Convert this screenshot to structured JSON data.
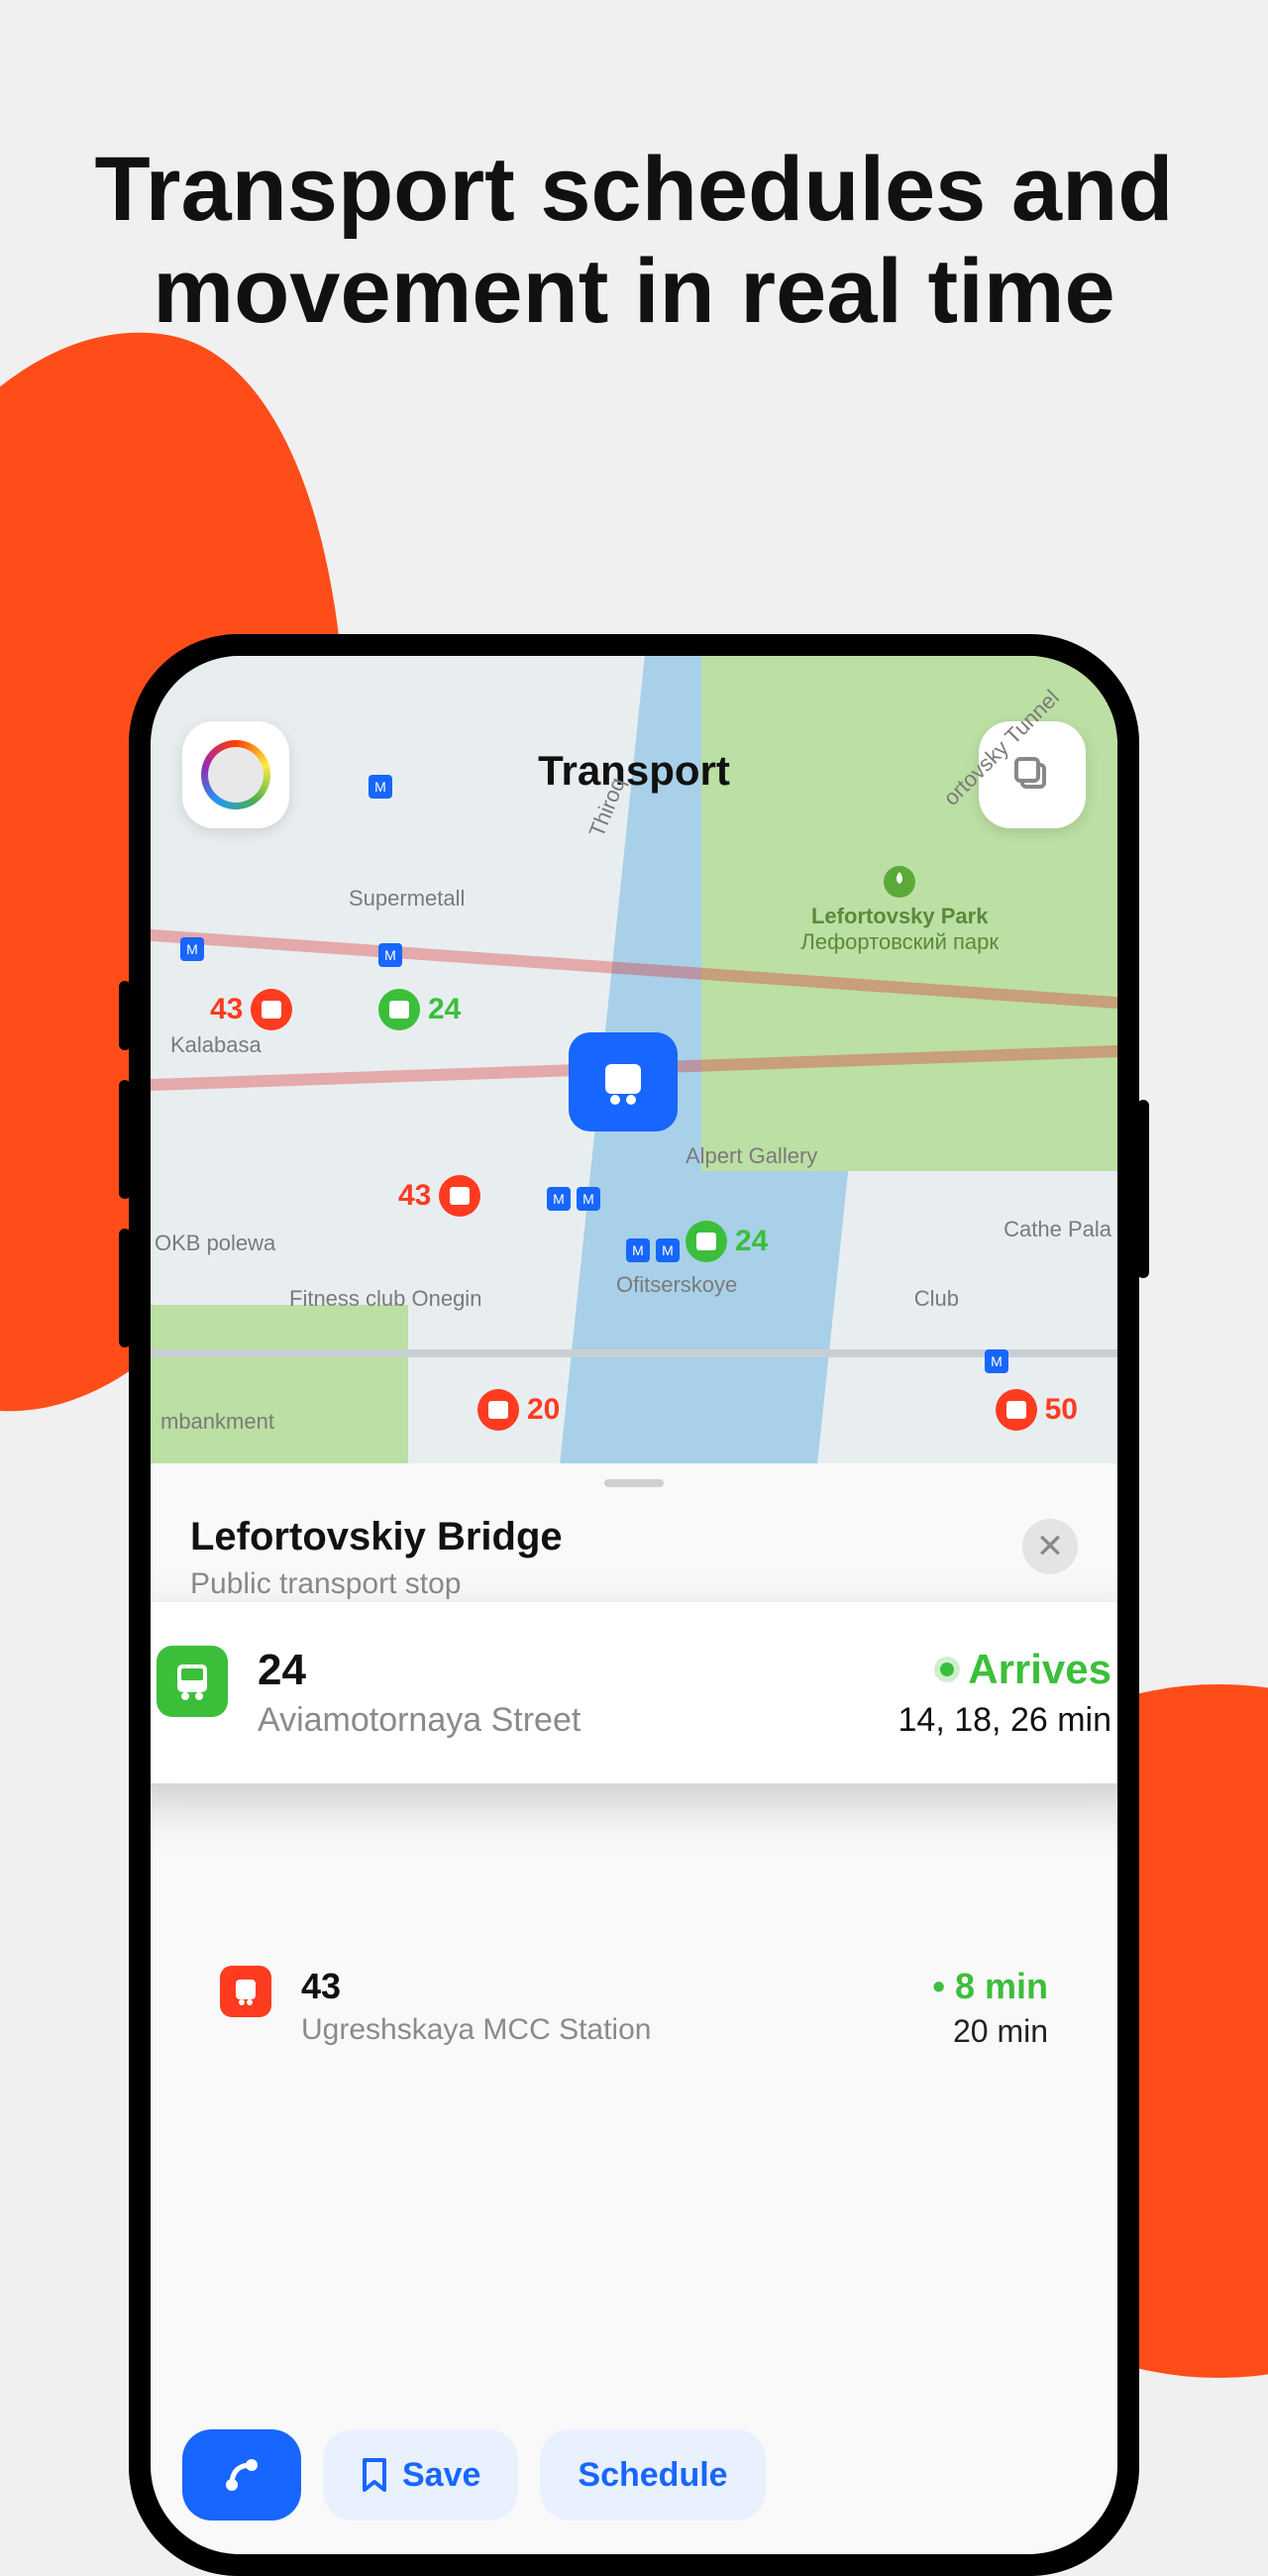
{
  "headline": "Transport schedules and movement in real time",
  "map": {
    "title": "Transport",
    "park": {
      "name": "Lefortovsky Park",
      "name_ru": "Лефортовский парк"
    },
    "pois": [
      {
        "name": "Supermetall"
      },
      {
        "name": "Kalabasa"
      },
      {
        "name": "Thiroq"
      },
      {
        "name": "Alpert Gallery"
      },
      {
        "name": "Ofitserskoye"
      },
      {
        "name": "OKB polewa"
      },
      {
        "name": "Fitness club Onegin"
      },
      {
        "name": "Club"
      },
      {
        "name": "Cathe Pala"
      },
      {
        "name": "mbankment"
      },
      {
        "name": "ortovsky Tunnel"
      }
    ],
    "vehicles": [
      {
        "type": "tram",
        "num": "43"
      },
      {
        "type": "bus",
        "num": "24"
      },
      {
        "type": "tram",
        "num": "43"
      },
      {
        "type": "bus",
        "num": "24"
      },
      {
        "type": "tram",
        "num": "20"
      },
      {
        "type": "tram",
        "num": "50"
      }
    ]
  },
  "sheet": {
    "title": "Lefortovskiy Bridge",
    "subtitle": "Public transport stop",
    "routes": [
      {
        "type": "bus",
        "num": "24",
        "dest": "Aviamotornaya Street",
        "status": "Arrives",
        "eta": "14, 18, 26 min"
      },
      {
        "type": "tram",
        "num": "43",
        "dest": "Ugreshskaya MCC Station",
        "next": "8 min",
        "after": "20 min"
      }
    ],
    "actions": {
      "save": "Save",
      "schedule": "Schedule"
    }
  }
}
